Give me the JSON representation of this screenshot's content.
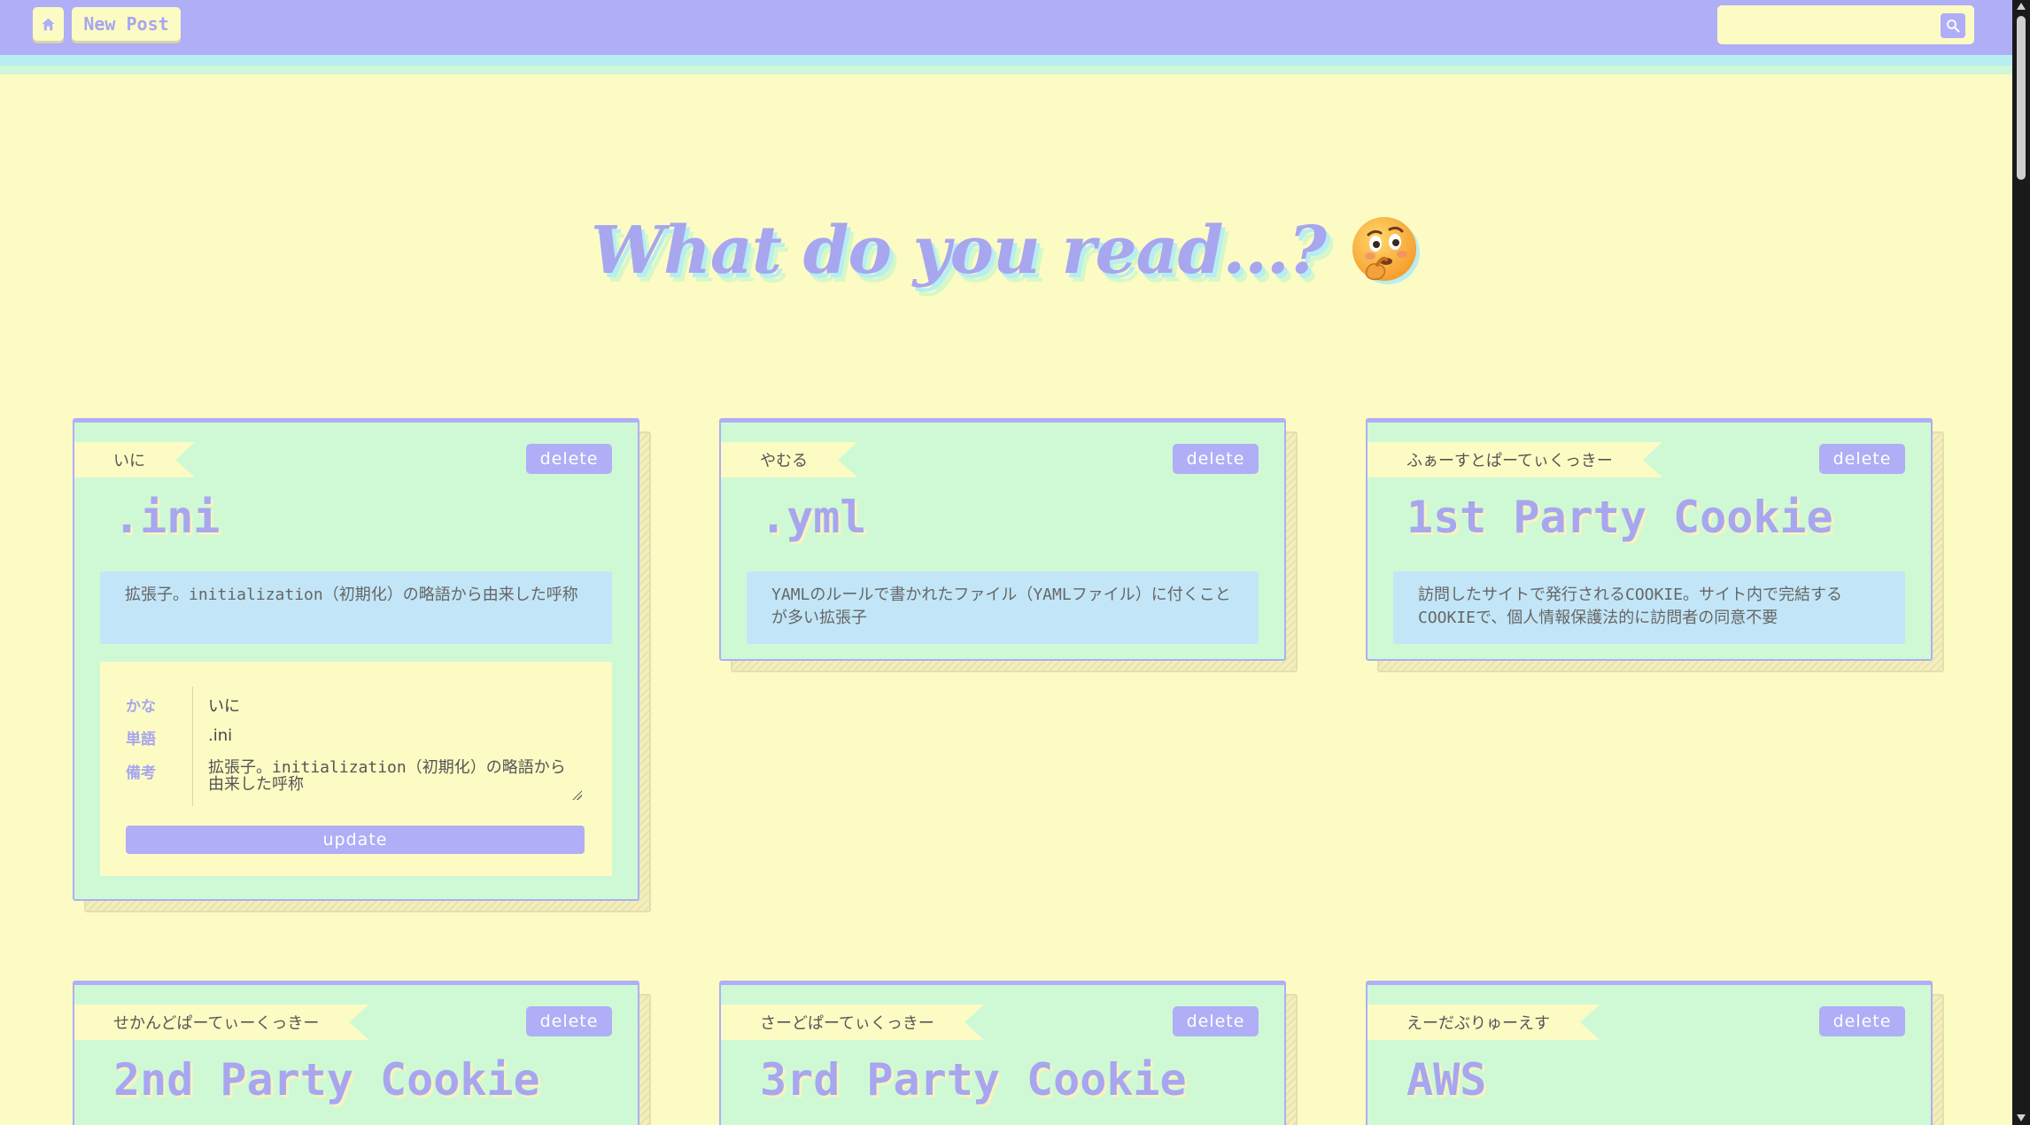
{
  "header": {
    "home_icon": "home-icon",
    "new_post_label": "New Post",
    "search_placeholder": "",
    "search_icon": "search-icon"
  },
  "page": {
    "title": "What do you read...?",
    "title_emoji": "thinking-face-icon"
  },
  "cards": [
    {
      "reading": "いに",
      "word": ".ini",
      "note": "拡張子。initialization（初期化）の略語から由来した呼称",
      "delete_label": "delete",
      "expanded": true,
      "edit": {
        "label_reading": "かな",
        "label_word": "単語",
        "label_note": "備考",
        "value_reading": "いに",
        "value_word": ".ini",
        "value_note": "拡張子。initialization（初期化）の略語から由来した呼称",
        "update_label": "update"
      }
    },
    {
      "reading": "やむる",
      "word": ".yml",
      "note": "YAMLのルールで書かれたファイル（YAMLファイル）に付くことが多い拡張子",
      "delete_label": "delete",
      "expanded": false
    },
    {
      "reading": "ふぁーすとぱーてぃくっきー",
      "word": "1st Party Cookie",
      "note": "訪問したサイトで発行されるCOOKIE。サイト内で完結するCOOKIEで、個人情報保護法的に訪問者の同意不要",
      "delete_label": "delete",
      "expanded": false
    },
    {
      "reading": "せかんどぱーてぃーくっきー",
      "word": "2nd Party Cookie",
      "delete_label": "delete",
      "expanded": false
    },
    {
      "reading": "さーどぱーてぃくっきー",
      "word": "3rd Party Cookie",
      "delete_label": "delete",
      "expanded": false
    },
    {
      "reading": "えーだぶりゅーえす",
      "word": "AWS",
      "delete_label": "delete",
      "expanded": false
    }
  ],
  "colors": {
    "background": "#fdfbc4",
    "accent": "#afaef6",
    "card": "#cff9d5",
    "note": "#c2e6f7"
  }
}
